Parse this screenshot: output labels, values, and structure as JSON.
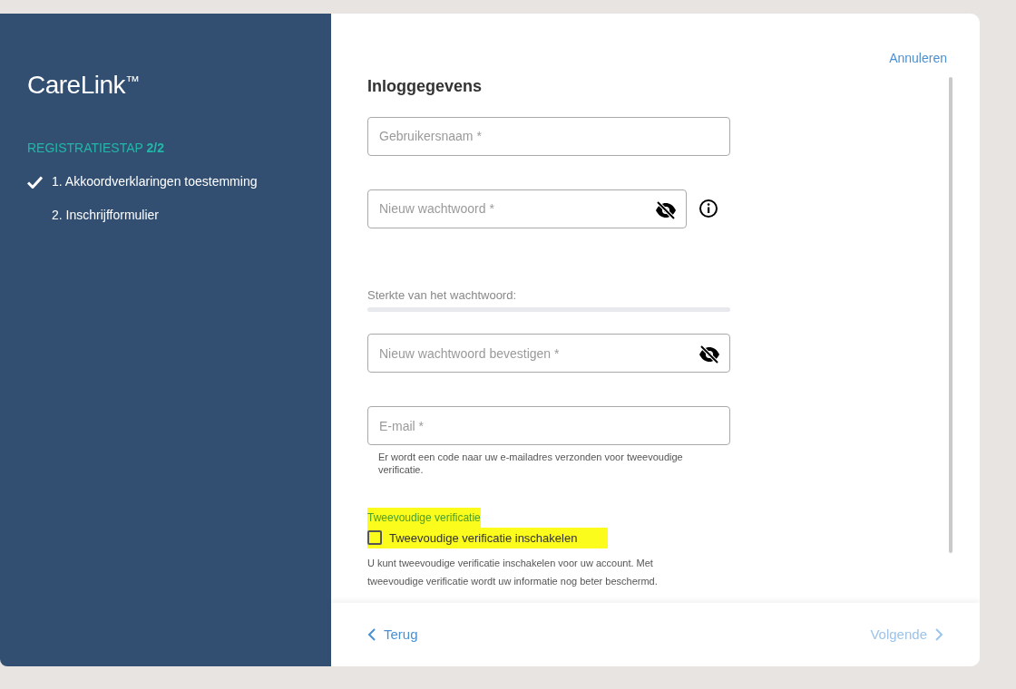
{
  "sidebar": {
    "logo": "CareLink",
    "logo_mark": "™",
    "step_counter": "REGISTRATIESTAP **2/2**",
    "steps": [
      {
        "label": "1. Akkoordverklaringen toestemming",
        "done": true
      },
      {
        "label": "2. Inschrijfformulier",
        "done": false
      }
    ]
  },
  "cancel_link": "Annuleren",
  "form": {
    "title": "Inloggegevens",
    "username": {
      "placeholder": "Gebruikersnaam *"
    },
    "password": {
      "placeholder": "Nieuw wachtwoord *"
    },
    "strength": {
      "label": "Sterkte van het wachtwoord:",
      "level": 0
    },
    "confirm": {
      "placeholder": "Nieuw wachtwoord bevestigen *"
    },
    "email": {
      "placeholder": "E-mail *",
      "help": "Er wordt een code naar uw e-mailadres verzonden voor tweevoudige verificatie."
    },
    "two_factor": {
      "title": "Tweevoudige verificatie",
      "checkbox_label": "Tweevoudige verificatie inschakelen",
      "checked": false,
      "highlighted": true,
      "description": "U kunt tweevoudige verificatie inschakelen voor uw account. Met tweevoudige verificatie wordt uw informatie nog beter beschermd."
    }
  },
  "footer": {
    "back": {
      "label": "Terug",
      "disabled": false
    },
    "next": {
      "label": "Volgende",
      "disabled": true
    }
  }
}
